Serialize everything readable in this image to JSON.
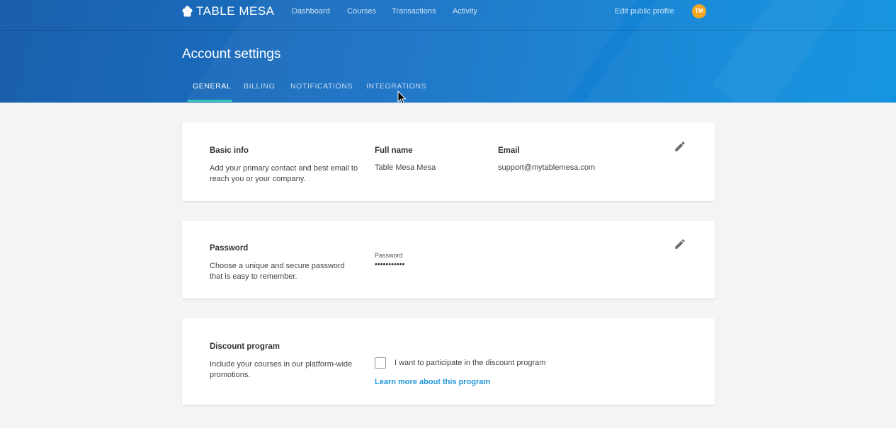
{
  "brand": {
    "name": "TABLE MESA"
  },
  "nav": {
    "items": [
      {
        "label": "Dashboard"
      },
      {
        "label": "Courses"
      },
      {
        "label": "Transactions"
      },
      {
        "label": "Activity"
      }
    ],
    "edit_profile": "Edit public profile",
    "avatar_initials": "TM"
  },
  "page": {
    "title": "Account settings"
  },
  "tabs": [
    {
      "label": "GENERAL",
      "active": true
    },
    {
      "label": "BILLING",
      "active": false
    },
    {
      "label": "NOTIFICATIONS",
      "active": false
    },
    {
      "label": "INTEGRATIONS",
      "active": false
    }
  ],
  "basic_info": {
    "title": "Basic info",
    "description": "Add your primary contact and best email to reach you or your company.",
    "full_name_label": "Full name",
    "full_name_value": "Table Mesa Mesa",
    "email_label": "Email",
    "email_value": "support@mytablemesa.com",
    "edit_icon": "pencil-icon"
  },
  "password": {
    "title": "Password",
    "description": "Choose a unique and secure password that is easy to remember.",
    "field_label": "Password",
    "field_value": "•••••••••••",
    "edit_icon": "pencil-icon"
  },
  "discount": {
    "title": "Discount program",
    "description": "Include your courses in our platform-wide promotions.",
    "checkbox_label": "I want to participate in the discount program",
    "checkbox_checked": false,
    "link_label": "Learn more about this program"
  },
  "colors": {
    "header_start": "#1a5fab",
    "header_end": "#0f92de",
    "tab_indicator": "#35c6b6",
    "avatar": "#f5a623",
    "link": "#2196d8",
    "background": "#f2f4f5"
  }
}
